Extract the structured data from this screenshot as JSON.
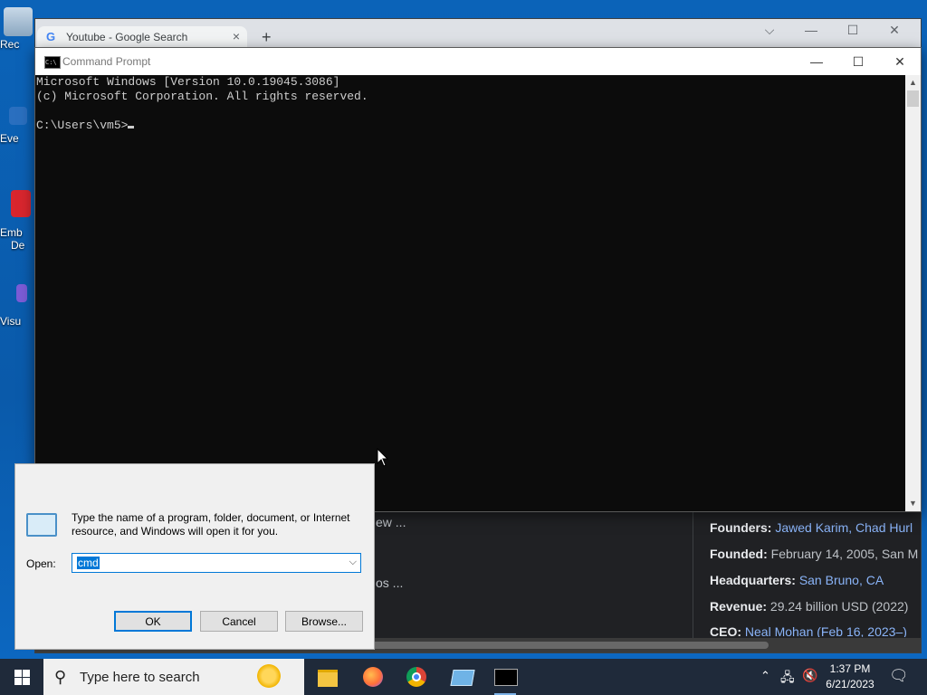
{
  "desktop": {
    "icons": [
      {
        "label": "Rec",
        "icon": "recycle-bin-icon"
      },
      {
        "label": "Eve",
        "icon": "app-shortcut-icon"
      },
      {
        "label": "Emb",
        "label2": "De",
        "icon": "red-app-icon"
      },
      {
        "label": "Visu",
        "icon": "visual-studio-icon"
      }
    ]
  },
  "chrome": {
    "tab_title": "Youtube - Google Search",
    "new_tab": "+",
    "controls": {
      "dropdown": "⌵",
      "minimize": "—",
      "maximize": "☐",
      "close": "✕"
    },
    "fragments": {
      "line1": "ew ...",
      "line2": "os ..."
    },
    "facts": [
      {
        "label": "Founders:",
        "value": "Jawed Karim, Chad Hurl",
        "link": true
      },
      {
        "label": "Founded:",
        "value": "February 14, 2005, San M",
        "link": false
      },
      {
        "label": "Headquarters:",
        "value": "San Bruno, CA",
        "link": true
      },
      {
        "label": "Revenue:",
        "value": "29.24 billion USD (2022)",
        "link": false
      },
      {
        "label": "CEO:",
        "value": "Neal Mohan (Feb 16, 2023–)",
        "link": true
      }
    ]
  },
  "cmd": {
    "title": "Command Prompt",
    "lines": [
      "Microsoft Windows [Version 10.0.19045.3086]",
      "(c) Microsoft Corporation. All rights reserved.",
      "",
      "C:\\Users\\vm5>"
    ],
    "controls": {
      "minimize": "—",
      "maximize": "☐",
      "close": "✕"
    }
  },
  "run": {
    "description": "Type the name of a program, folder, document, or Internet resource, and Windows will open it for you.",
    "open_label": "Open:",
    "input_value": "cmd",
    "ok": "OK",
    "cancel": "Cancel",
    "browse": "Browse..."
  },
  "taskbar": {
    "search_placeholder": "Type here to search",
    "time": "1:37 PM",
    "date": "6/21/2023"
  }
}
